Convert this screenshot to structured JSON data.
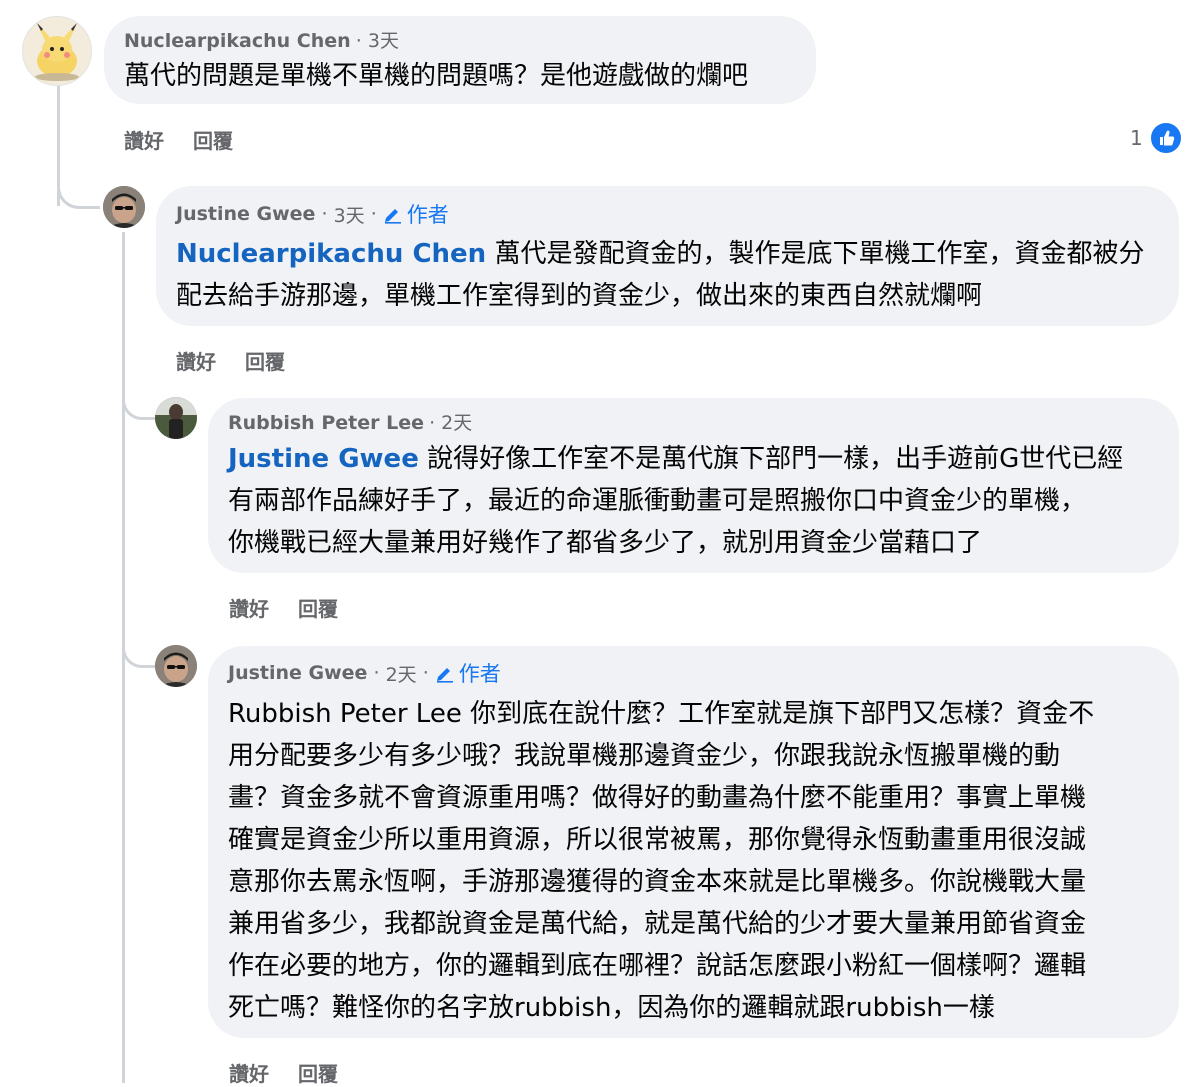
{
  "comments": [
    {
      "author": "Nuclearpikachu Chen",
      "time": "3天",
      "text": "萬代的問題是單機不單機的問題嗎？是他遊戲做的爛吧",
      "like_label": "讚好",
      "reply_label": "回覆",
      "reaction_count": "1"
    },
    {
      "author": "Justine Gwee",
      "time": "3天",
      "badge": "作者",
      "mention": "Nuclearpikachu Chen",
      "line1": "萬代是發配資金的，製作是底下單機工作室，資金都被分",
      "line2": "配去給手游那邊，單機工作室得到的資金少，做出來的東西自然就爛啊",
      "like_label": "讚好",
      "reply_label": "回覆"
    },
    {
      "author": "Rubbish Peter Lee",
      "time": "2天",
      "mention": "Justine Gwee",
      "line1": "說得好像工作室不是萬代旗下部門一樣，出手遊前G世代已經",
      "line2": "有兩部作品練好手了，最近的命運脈衝動畫可是照搬你口中資金少的單機，",
      "line3": "你機戰已經大量兼用好幾作了都省多少了，就別用資金少當藉口了",
      "like_label": "讚好",
      "reply_label": "回覆"
    },
    {
      "author": "Justine Gwee",
      "time": "2天",
      "badge": "作者",
      "lines": [
        "Rubbish Peter Lee 你到底在說什麼？工作室就是旗下部門又怎樣？資金不",
        "用分配要多少有多少哦？我說單機那邊資金少，你跟我說永恆搬單機的動",
        "畫？資金多就不會資源重用嗎？做得好的動畫為什麼不能重用？事實上單機",
        "確實是資金少所以重用資源，所以很常被罵，那你覺得永恆動畫重用很沒誠",
        "意那你去罵永恆啊，手游那邊獲得的資金本來就是比單機多。你說機戰大量",
        "兼用省多少，我都說資金是萬代給，就是萬代給的少才要大量兼用節省資金",
        "作在必要的地方，你的邏輯到底在哪裡？說話怎麼跟小粉紅一個樣啊？邏輯",
        "死亡嗎？難怪你的名字放rubbish，因為你的邏輯就跟rubbish一樣"
      ],
      "like_label": "讚好",
      "reply_label": "回覆"
    }
  ],
  "icons": {
    "like_reaction": "thumbs-up-icon",
    "author_badge": "pencil-icon"
  },
  "colors": {
    "bubble": "#f0f2f5",
    "mention": "#1565c0",
    "like_blue": "#1877f2",
    "meta_gray": "#65676b"
  }
}
